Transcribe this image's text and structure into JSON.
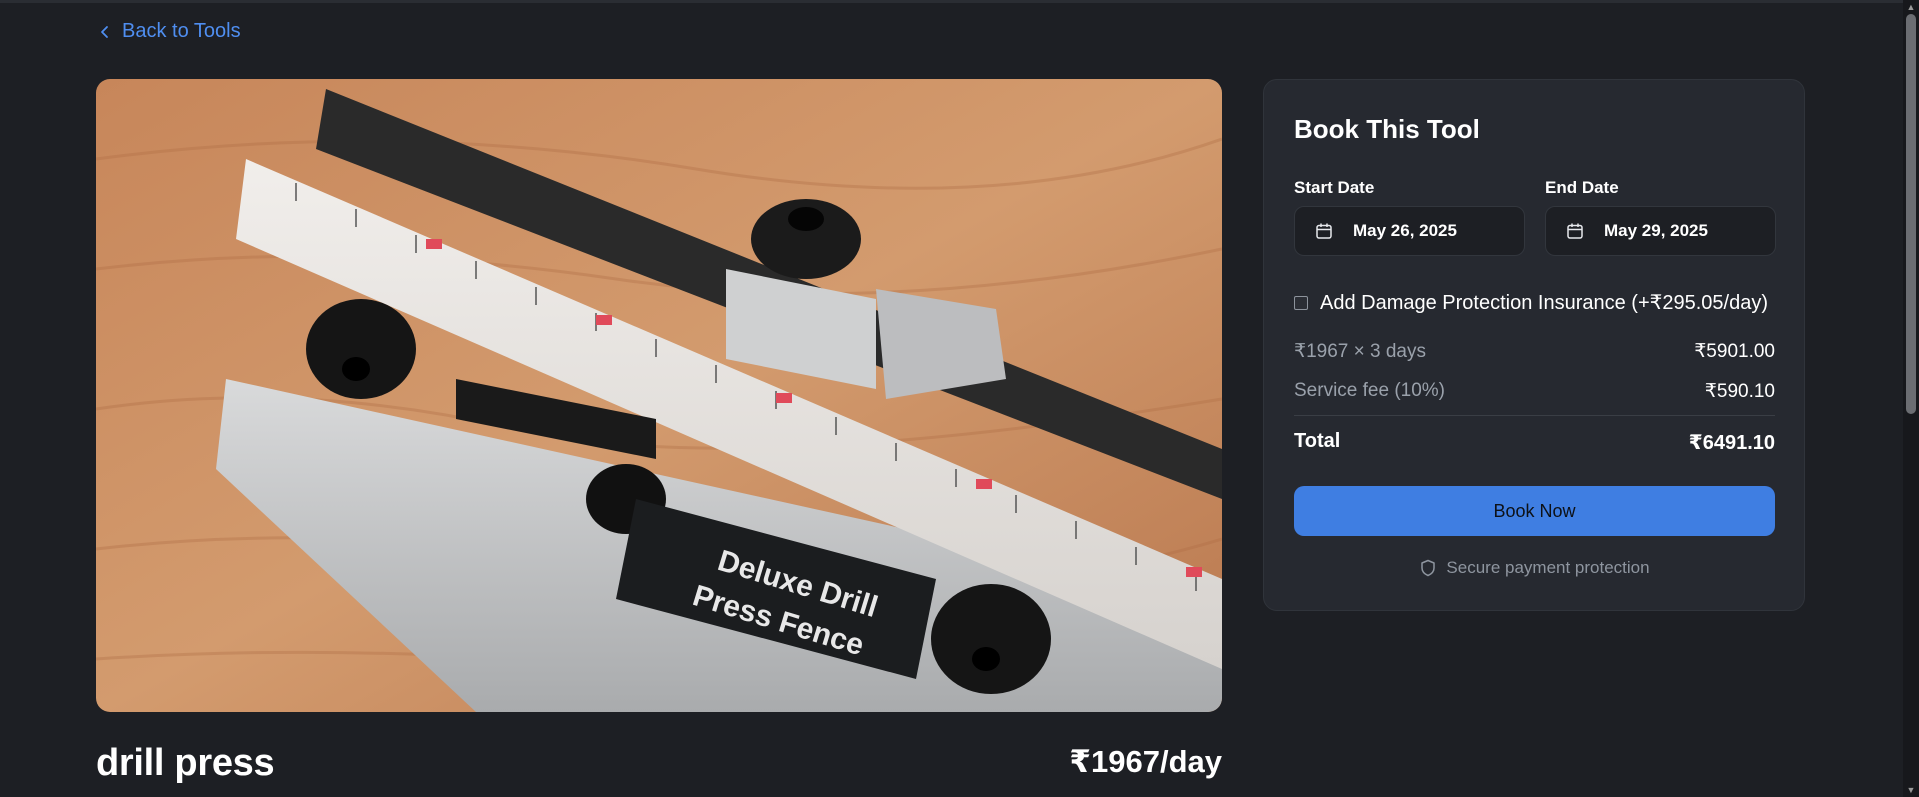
{
  "nav": {
    "back_label": "Back to Tools"
  },
  "tool": {
    "name": "drill press",
    "price": "₹1967/day",
    "image_label_line1": "Deluxe Drill",
    "image_label_line2": "Press Fence"
  },
  "booking": {
    "title": "Book This Tool",
    "start_label": "Start Date",
    "start_value": "May 26, 2025",
    "end_label": "End Date",
    "end_value": "May 29, 2025",
    "insurance_label": "Add Damage Protection Insurance (+₹295.05/day)",
    "insurance_checked": false,
    "rental_line_label": "₹1967 × 3 days",
    "rental_line_value": "₹5901.00",
    "fee_label": "Service fee (10%)",
    "fee_value": "₹590.10",
    "total_label": "Total",
    "total_value": "₹6491.10",
    "book_button": "Book Now",
    "secure_text": "Secure payment protection"
  },
  "icons": {
    "back": "chevron-left-icon",
    "calendar": "calendar-icon",
    "shield": "shield-icon"
  },
  "colors": {
    "accent": "#3f7ee2",
    "link": "#4f8ef0",
    "background": "#1d1f24",
    "card": "#262930"
  }
}
